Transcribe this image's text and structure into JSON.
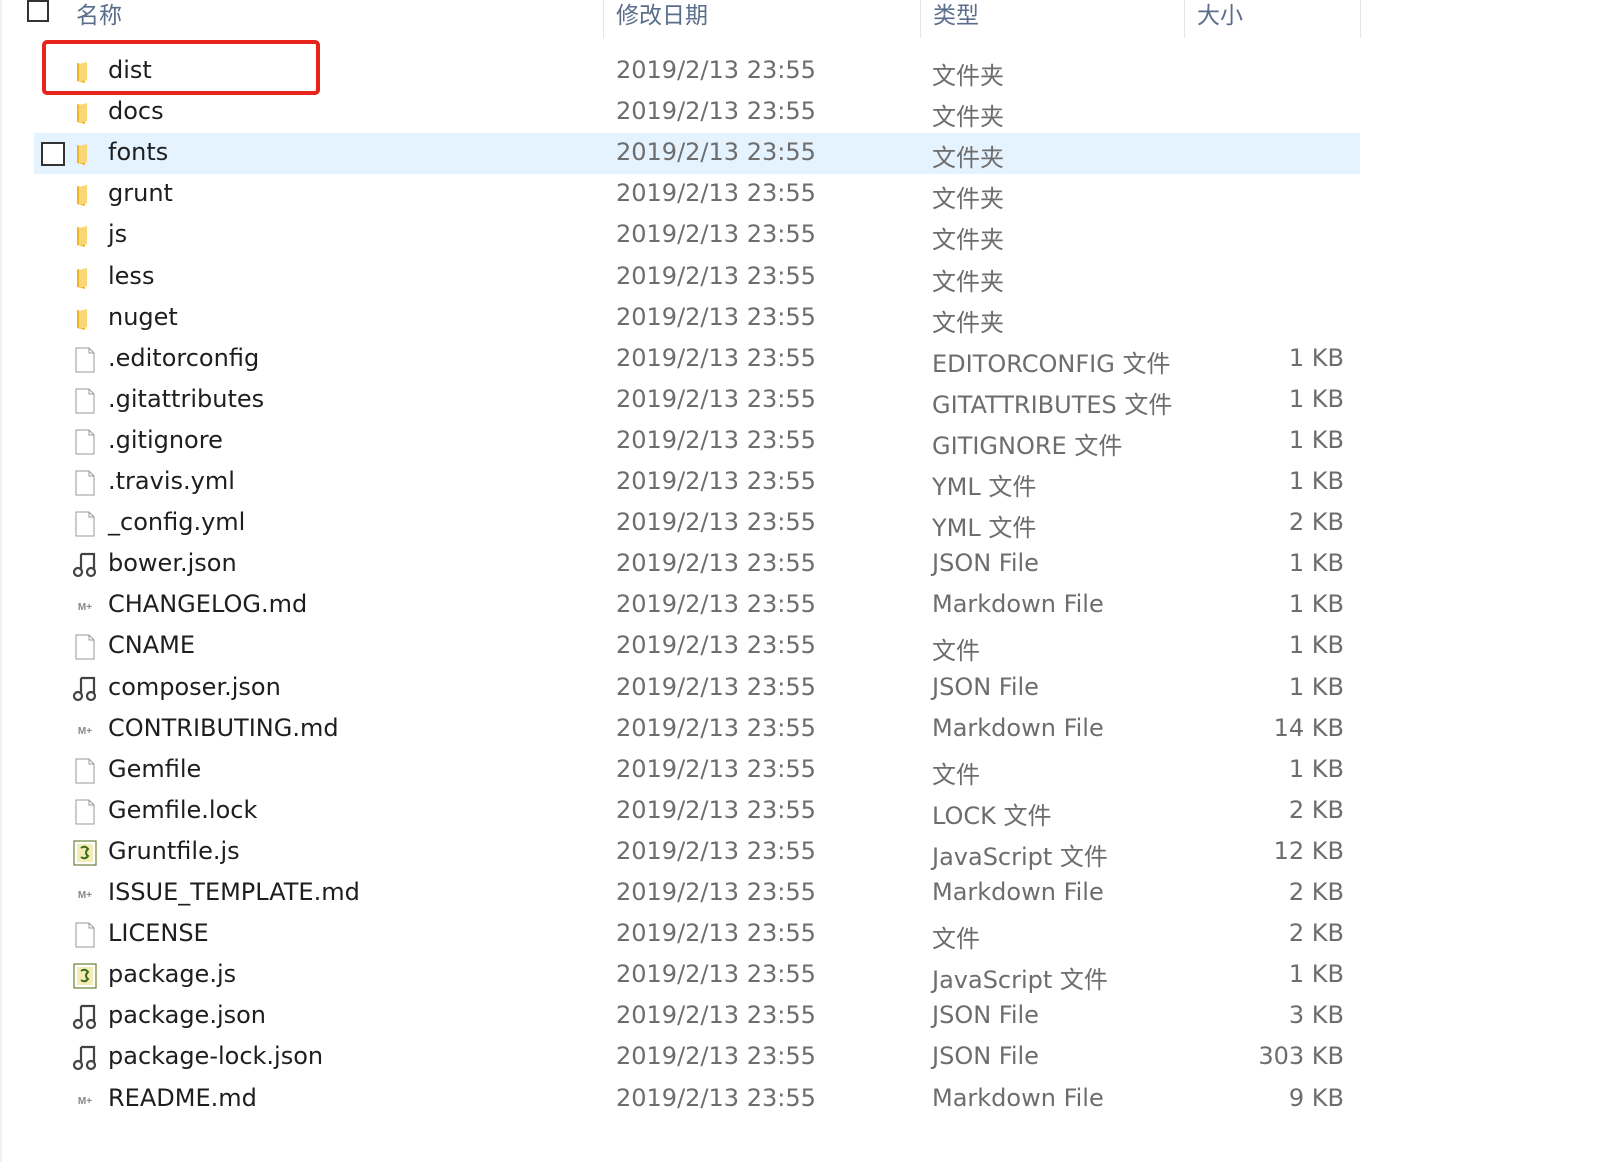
{
  "header": {
    "name": "名称",
    "date": "修改日期",
    "type": "类型",
    "size": "大小"
  },
  "hover_row_index": 2,
  "highlight_row_index": 0,
  "colors": {
    "hover": "#e5f3ff",
    "highlight_border": "#e8231b",
    "folder": "#f5c542"
  },
  "files": [
    {
      "name": "dist",
      "date": "2019/2/13 23:55",
      "type": "文件夹",
      "size": "",
      "icon": "folder-icon"
    },
    {
      "name": "docs",
      "date": "2019/2/13 23:55",
      "type": "文件夹",
      "size": "",
      "icon": "folder-icon"
    },
    {
      "name": "fonts",
      "date": "2019/2/13 23:55",
      "type": "文件夹",
      "size": "",
      "icon": "folder-icon"
    },
    {
      "name": "grunt",
      "date": "2019/2/13 23:55",
      "type": "文件夹",
      "size": "",
      "icon": "folder-icon"
    },
    {
      "name": "js",
      "date": "2019/2/13 23:55",
      "type": "文件夹",
      "size": "",
      "icon": "folder-icon"
    },
    {
      "name": "less",
      "date": "2019/2/13 23:55",
      "type": "文件夹",
      "size": "",
      "icon": "folder-icon"
    },
    {
      "name": "nuget",
      "date": "2019/2/13 23:55",
      "type": "文件夹",
      "size": "",
      "icon": "folder-icon"
    },
    {
      "name": ".editorconfig",
      "date": "2019/2/13 23:55",
      "type": "EDITORCONFIG 文件",
      "size": "1 KB",
      "icon": "file-icon"
    },
    {
      "name": ".gitattributes",
      "date": "2019/2/13 23:55",
      "type": "GITATTRIBUTES 文件",
      "size": "1 KB",
      "icon": "file-icon"
    },
    {
      "name": ".gitignore",
      "date": "2019/2/13 23:55",
      "type": "GITIGNORE 文件",
      "size": "1 KB",
      "icon": "file-icon"
    },
    {
      "name": ".travis.yml",
      "date": "2019/2/13 23:55",
      "type": "YML 文件",
      "size": "1 KB",
      "icon": "file-icon"
    },
    {
      "name": "_config.yml",
      "date": "2019/2/13 23:55",
      "type": "YML 文件",
      "size": "2 KB",
      "icon": "file-icon"
    },
    {
      "name": "bower.json",
      "date": "2019/2/13 23:55",
      "type": "JSON File",
      "size": "1 KB",
      "icon": "json-icon"
    },
    {
      "name": "CHANGELOG.md",
      "date": "2019/2/13 23:55",
      "type": "Markdown File",
      "size": "1 KB",
      "icon": "markdown-icon"
    },
    {
      "name": "CNAME",
      "date": "2019/2/13 23:55",
      "type": "文件",
      "size": "1 KB",
      "icon": "file-icon"
    },
    {
      "name": "composer.json",
      "date": "2019/2/13 23:55",
      "type": "JSON File",
      "size": "1 KB",
      "icon": "json-icon"
    },
    {
      "name": "CONTRIBUTING.md",
      "date": "2019/2/13 23:55",
      "type": "Markdown File",
      "size": "14 KB",
      "icon": "markdown-icon"
    },
    {
      "name": "Gemfile",
      "date": "2019/2/13 23:55",
      "type": "文件",
      "size": "1 KB",
      "icon": "file-icon"
    },
    {
      "name": "Gemfile.lock",
      "date": "2019/2/13 23:55",
      "type": "LOCK 文件",
      "size": "2 KB",
      "icon": "file-icon"
    },
    {
      "name": "Gruntfile.js",
      "date": "2019/2/13 23:55",
      "type": "JavaScript 文件",
      "size": "12 KB",
      "icon": "script-icon"
    },
    {
      "name": "ISSUE_TEMPLATE.md",
      "date": "2019/2/13 23:55",
      "type": "Markdown File",
      "size": "2 KB",
      "icon": "markdown-icon"
    },
    {
      "name": "LICENSE",
      "date": "2019/2/13 23:55",
      "type": "文件",
      "size": "2 KB",
      "icon": "file-icon"
    },
    {
      "name": "package.js",
      "date": "2019/2/13 23:55",
      "type": "JavaScript 文件",
      "size": "1 KB",
      "icon": "script-icon"
    },
    {
      "name": "package.json",
      "date": "2019/2/13 23:55",
      "type": "JSON File",
      "size": "3 KB",
      "icon": "json-icon"
    },
    {
      "name": "package-lock.json",
      "date": "2019/2/13 23:55",
      "type": "JSON File",
      "size": "303 KB",
      "icon": "json-icon"
    },
    {
      "name": "README.md",
      "date": "2019/2/13 23:55",
      "type": "Markdown File",
      "size": "9 KB",
      "icon": "markdown-icon"
    }
  ]
}
